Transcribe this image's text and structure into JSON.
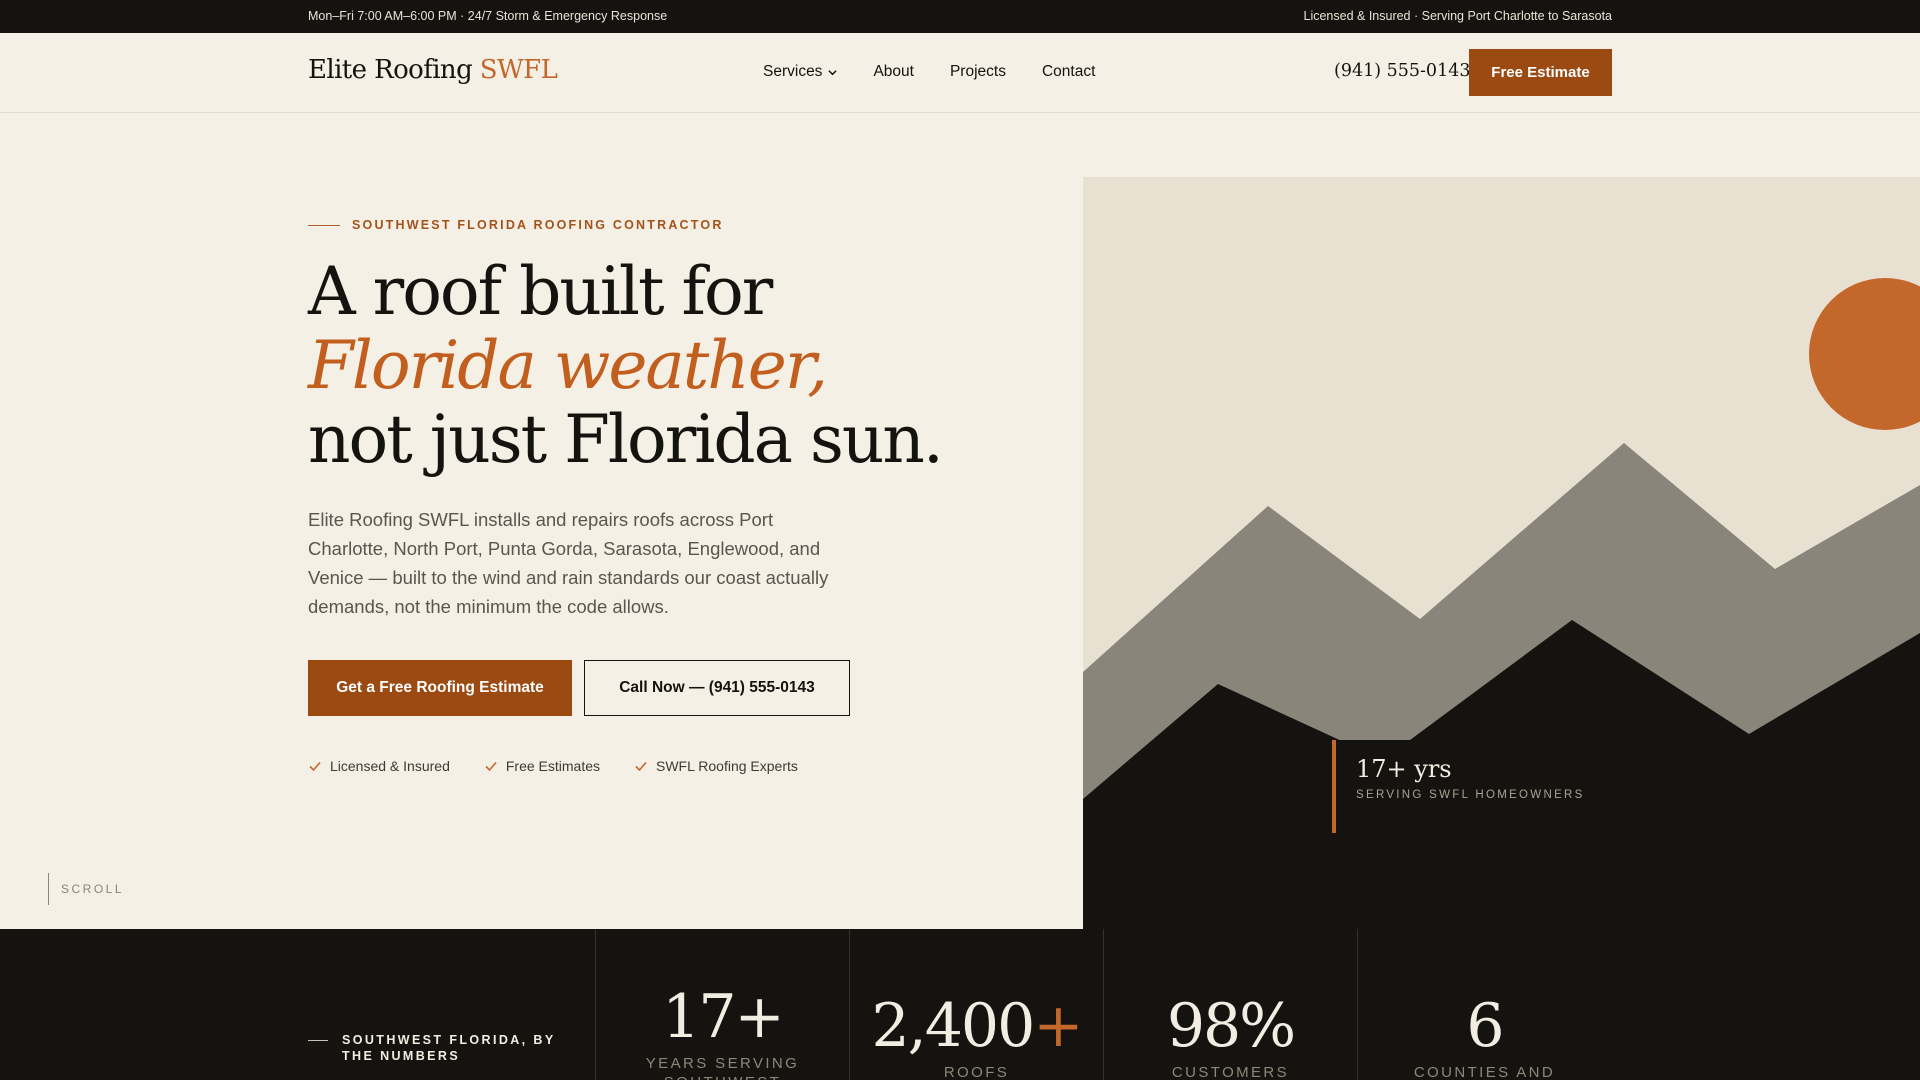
{
  "topbar": {
    "hours": "Mon–Fri 7:00 AM–6:00 PM · 24/7 Storm & Emergency Response",
    "license": "Licensed & Insured · Serving Port Charlotte to Sarasota"
  },
  "header": {
    "logo_main": "Elite Roofing",
    "logo_accent": "SWFL",
    "nav": [
      "Services",
      "About",
      "Projects",
      "Contact"
    ],
    "phone": "(941) 555-0143",
    "cta": "Free Estimate"
  },
  "hero": {
    "eyebrow": "SOUTHWEST FLORIDA ROOFING CONTRACTOR",
    "headline_1": "A roof built for",
    "headline_2": "Florida weather,",
    "headline_3": "not just Florida sun.",
    "lead": "Elite Roofing SWFL installs and repairs roofs across Port Charlotte, North Port, Punta Gorda, Sarasota, Englewood, and Venice — built to the wind and rain standards our coast actually demands, not the minimum the code allows.",
    "primary_cta": "Get a Free Roofing Estimate",
    "secondary_cta": "Call Now — (941) 555-0143",
    "badges": [
      "Licensed & Insured",
      "Free Estimates",
      "SWFL Roofing Experts"
    ],
    "scroll": "SCROLL",
    "callout_big": "17+ yrs",
    "callout_small": "SERVING SWFL HOMEOWNERS"
  },
  "stats": {
    "label": "SOUTHWEST FLORIDA, BY THE NUMBERS",
    "items": [
      {
        "value": "17",
        "suffix": "+",
        "caption": "YEARS SERVING SOUTHWEST"
      },
      {
        "value": "2,400",
        "suffix": "+",
        "caption": "ROOFS"
      },
      {
        "value": "98%",
        "suffix": "",
        "caption": "CUSTOMERS"
      },
      {
        "value": "6",
        "suffix": "",
        "caption": "COUNTIES AND"
      }
    ]
  },
  "colors": {
    "accent": "#c4672a",
    "button": "#9b4a12",
    "dark": "#14130f",
    "cream": "#f4f0e6"
  }
}
